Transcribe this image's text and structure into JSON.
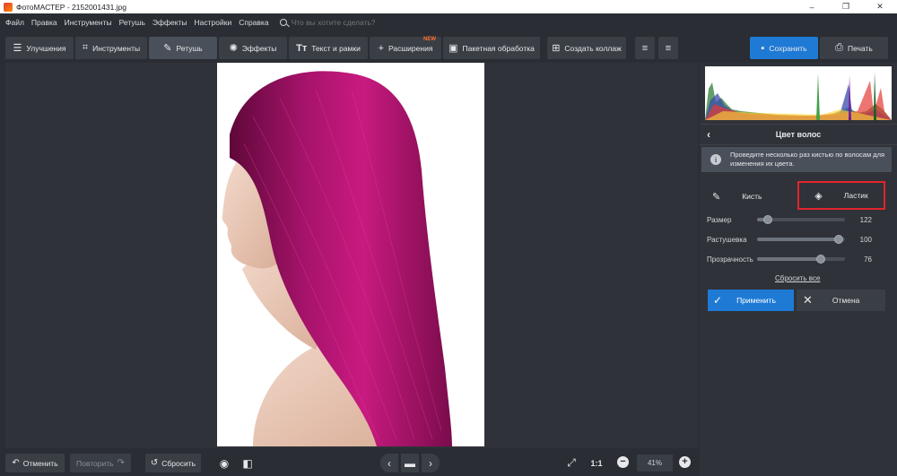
{
  "window": {
    "title": "ФотоМАСТЕР - 2152001431.jpg",
    "controls": [
      "–",
      "❐",
      "✕"
    ]
  },
  "menu": {
    "items": [
      "Файл",
      "Правка",
      "Инструменты",
      "Ретушь",
      "Эффекты",
      "Настройки",
      "Справка"
    ],
    "search_placeholder": "Что вы хотите сделать?"
  },
  "toolbar": {
    "improvements": "Улучшения",
    "tools": "Инструменты",
    "retouch": "Ретушь",
    "effects": "Эффекты",
    "text_frames": "Текст и рамки",
    "extensions": "Расширения",
    "new_badge": "NEW",
    "batch": "Пакетная обработка",
    "collage": "Создать коллаж",
    "save": "Сохранить",
    "print": "Печать"
  },
  "bottom": {
    "undo": "Отменить",
    "redo": "Повторить",
    "reset": "Сбросить",
    "ratio": "1:1",
    "zoom": "41%"
  },
  "panel": {
    "title": "Цвет волос",
    "hint": "Проведите несколько раз кистью по волосам для изменения их цвета.",
    "brush": "Кисть",
    "eraser": "Ластик",
    "sliders": [
      {
        "label": "Размер",
        "value": "122",
        "level": 0.12
      },
      {
        "label": "Растушевка",
        "value": "100",
        "level": 0.93
      },
      {
        "label": "Прозрачность",
        "value": "76",
        "level": 0.72
      }
    ],
    "reset_all": "Сбросить все",
    "apply": "Применить",
    "cancel": "Отмена"
  },
  "colors": {
    "accent": "#1f7ad6",
    "highlight": "#e3242b",
    "hair": "#9c0f62"
  },
  "histogram": {
    "channels": [
      "green",
      "blue",
      "yellow",
      "red",
      "magenta"
    ]
  }
}
